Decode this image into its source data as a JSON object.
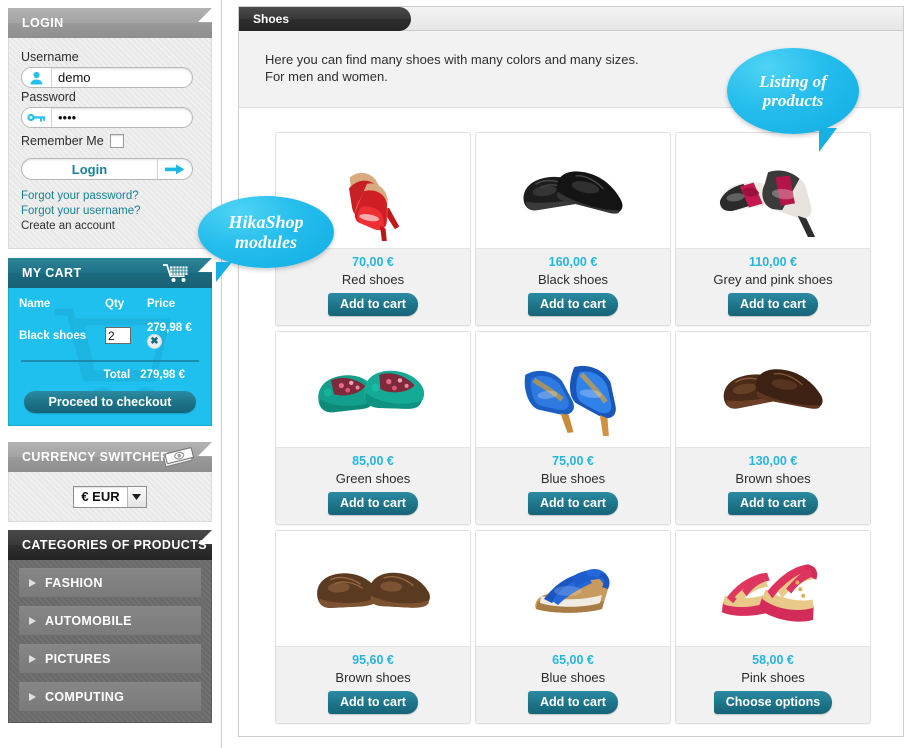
{
  "sidebar": {
    "login": {
      "title": "LOGIN",
      "username_label": "Username",
      "username_value": "demo",
      "username_placeholder": "Username",
      "password_label": "Password",
      "password_value": "••••",
      "password_placeholder": "Password",
      "remember_label": "Remember Me",
      "login_button": "Login",
      "links": [
        "Forgot your password?",
        "Forgot your username?",
        "Create an account"
      ]
    },
    "cart": {
      "title": "MY CART",
      "columns": [
        "Name",
        "Qty",
        "Price"
      ],
      "items": [
        {
          "name": "Black shoes",
          "qty": "2",
          "price": "279,98 €",
          "remove": "✖"
        }
      ],
      "total_label": "Total",
      "total_value": "279,98 €",
      "checkout_button": "Proceed to checkout"
    },
    "currency": {
      "title": "CURRENCY SWITCHER",
      "selected": "€ EUR",
      "options": [
        "€ EUR"
      ]
    },
    "categories": {
      "title": "CATEGORIES OF PRODUCTS",
      "items": [
        "FASHION",
        "AUTOMOBILE",
        "PICTURES",
        "COMPUTING"
      ]
    }
  },
  "main": {
    "tab": "Shoes",
    "intro_line1": "Here you can find many shoes with many colors and many sizes.",
    "intro_line2": "For men and women.",
    "products": [
      {
        "price": "70,00 €",
        "name": "Red shoes",
        "button": "Add to cart",
        "image": "red-pumps-photo"
      },
      {
        "price": "160,00 €",
        "name": "Black shoes",
        "button": "Add to cart",
        "image": "black-dress-shoes-photo"
      },
      {
        "price": "110,00 €",
        "name": "Grey and pink shoes",
        "button": "Add to cart",
        "image": "grey-pink-pumps-photo"
      },
      {
        "price": "85,00 €",
        "name": "Green shoes",
        "button": "Add to cart",
        "image": "green-flats-photo"
      },
      {
        "price": "75,00 €",
        "name": "Blue shoes",
        "button": "Add to cart",
        "image": "blue-pumps-photo"
      },
      {
        "price": "130,00 €",
        "name": "Brown shoes",
        "button": "Add to cart",
        "image": "brown-dress-shoes-photo"
      },
      {
        "price": "95,60 €",
        "name": "Brown shoes",
        "button": "Add to cart",
        "image": "brown-oxfords-photo"
      },
      {
        "price": "65,00 €",
        "name": "Blue shoes",
        "button": "Add to cart",
        "image": "blue-wedge-sandals-photo"
      },
      {
        "price": "58,00 €",
        "name": "Pink shoes",
        "button": "Choose options",
        "image": "pink-strappy-sandals-photo"
      }
    ]
  },
  "callouts": {
    "modules_line1": "HikaShop",
    "modules_line2": "modules",
    "products_line1": "Listing of",
    "products_line2": "products"
  },
  "colors": {
    "accent_cyan": "#22b7e0",
    "cart_bg": "#1fc0ee",
    "teal_button": "#1d7489",
    "dark_header": "#2e2e2e"
  }
}
